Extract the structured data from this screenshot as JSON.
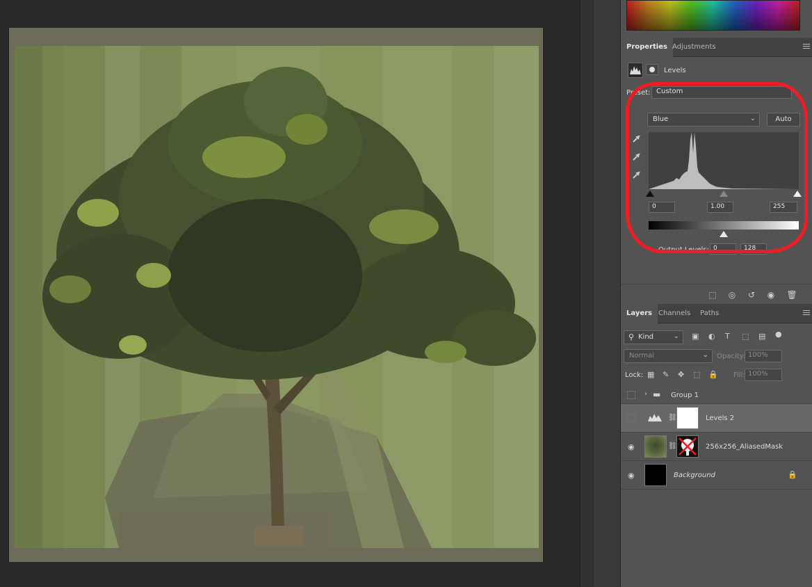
{
  "properties_panel": {
    "tabs": [
      {
        "label": "Properties"
      },
      {
        "label": "Adjustments"
      }
    ],
    "adjustment_type": "Levels",
    "preset_label": "Preset:",
    "preset_value": "Custom",
    "channel": "Blue",
    "auto_label": "Auto",
    "input_black": "0",
    "input_gamma": "1.00",
    "input_white": "255",
    "output_levels_label": "Output Levels:",
    "output_black": "0",
    "output_white": "128",
    "eyedropper_icons": [
      "black-point-eyedropper-icon",
      "gray-point-eyedropper-icon",
      "white-point-eyedropper-icon"
    ],
    "footer_icons": [
      "clip-to-layer-icon",
      "view-previous-icon",
      "reset-icon",
      "visibility-icon",
      "trash-icon"
    ]
  },
  "layers_panel": {
    "tabs": [
      {
        "label": "Layers"
      },
      {
        "label": "Channels"
      },
      {
        "label": "Paths"
      }
    ],
    "filter_kind": "Kind",
    "blend_mode": "Normal",
    "opacity_label": "Opacity:",
    "opacity_value": "100%",
    "lock_label": "Lock:",
    "fill_label": "Fill:",
    "fill_value": "100%",
    "layers": [
      {
        "name": "Group 1",
        "visible": false,
        "type": "group"
      },
      {
        "name": "Levels 2",
        "visible": false,
        "type": "adjustment",
        "selected": true
      },
      {
        "name": "256x256_AliasedMask",
        "visible": true,
        "type": "pixel"
      },
      {
        "name": "Background",
        "visible": true,
        "type": "background",
        "locked": true
      }
    ]
  },
  "annotation": {
    "color": "#ee1c24"
  }
}
